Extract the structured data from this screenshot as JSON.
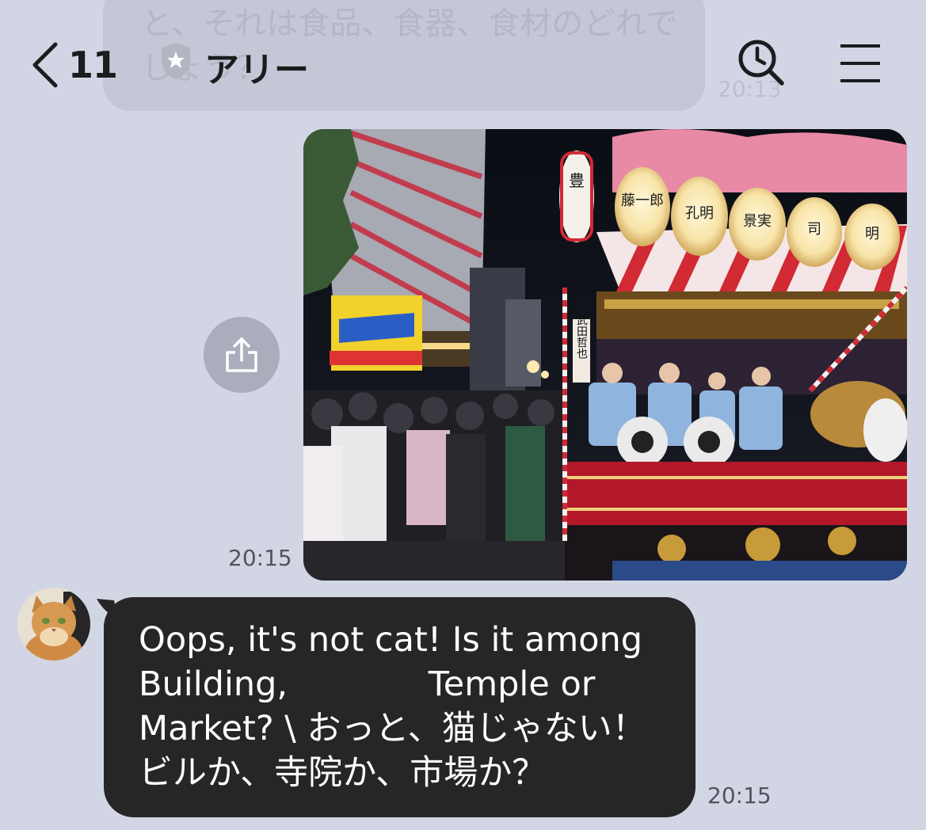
{
  "background_message": {
    "text": "と、それは食品、食器、食材のどれでしょう？",
    "time": "20:13"
  },
  "header": {
    "back_count": "11",
    "title": "アリー",
    "back_icon": "chevron-left-icon",
    "badge_icon": "shield-star-icon",
    "search_icon": "search-clock-icon",
    "menu_icon": "hamburger-menu-icon"
  },
  "photo_message": {
    "time": "20:15",
    "share_icon": "share-icon",
    "lantern_labels": [
      "豊",
      "藤一郎",
      "孔明",
      "景実",
      "司",
      "明"
    ],
    "side_lantern_label": "武田哲也"
  },
  "reply_message": {
    "text": "Oops, it's not cat! Is it among\nBuilding,             Temple or\nMarket? \\ おっと、猫じゃない！\nビルか、寺院か、市場か？",
    "time": "20:15"
  },
  "colors": {
    "background": "#d2d6e4",
    "bubble_dark": "#262626",
    "text_dark": "#1c1c1e",
    "time_text": "#505460"
  }
}
